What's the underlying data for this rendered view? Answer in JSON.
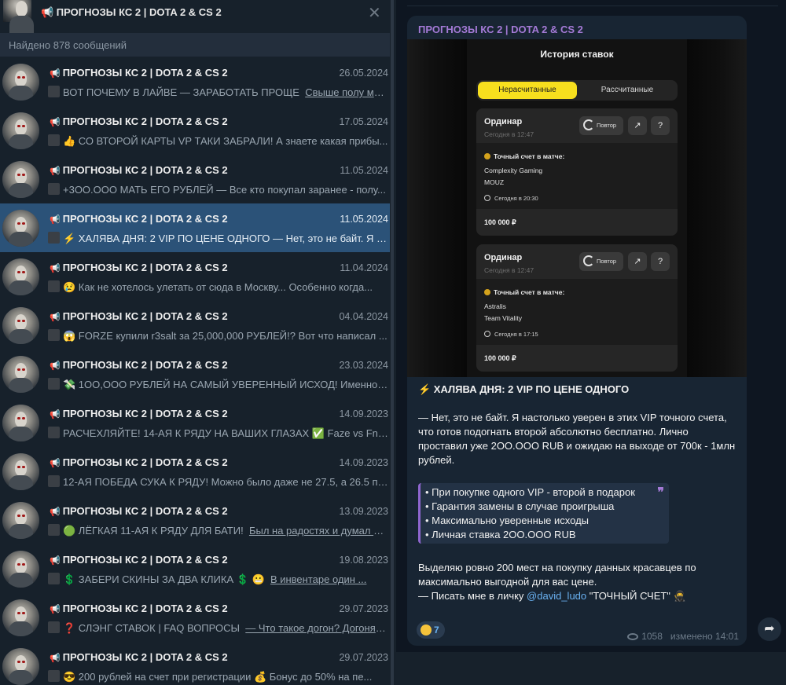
{
  "header": {
    "title": "📢 ПРОГНОЗЫ КС 2 | DOTA 2 & CS 2",
    "close_glyph": "✕"
  },
  "search": {
    "found_text": "Найдено 878 сообщений"
  },
  "results": [
    {
      "name": "ПРОГНОЗЫ КС 2 | DOTA 2 & CS 2",
      "date": "26.05.2024",
      "text": "ВОТ ПОЧЕМУ В ЛАЙВЕ — ЗАРАБОТАТЬ ПРОЩЕ",
      "extra": "Свыше полу мил..."
    },
    {
      "name": "ПРОГНОЗЫ КС 2 | DOTA 2 & CS 2",
      "date": "17.05.2024",
      "text": "👍 СО ВТОРОЙ КАРТЫ VP ТАКИ ЗАБРАЛИ!  А знаете какая прибы..."
    },
    {
      "name": "ПРОГНОЗЫ КС 2 | DOTA 2 & CS 2",
      "date": "11.05.2024",
      "text": "+3ОО.ООО МАТЬ ЕГО РУБЛЕЙ   — Все кто покупал заранее - полу..."
    },
    {
      "name": "ПРОГНОЗЫ КС 2 | DOTA 2 & CS 2",
      "date": "11.05.2024",
      "text": "⚡ ХАЛЯВА ДНЯ: 2 VIP ПО ЦЕНЕ ОДНОГО  — Нет, это не байт. Я н..."
    },
    {
      "name": "ПРОГНОЗЫ КС 2 | DOTA 2 & CS 2",
      "date": "11.04.2024",
      "text": "😢 Как не хотелось улетать от сюда в Москву...  Особенно когда..."
    },
    {
      "name": "ПРОГНОЗЫ КС 2 | DOTA 2 & CS 2",
      "date": "04.04.2024",
      "text": "😱 FORZE купили r3salt за 25,000,000 РУБЛЕЙ!?  Вот что написал ..."
    },
    {
      "name": "ПРОГНОЗЫ КС 2 | DOTA 2 & CS 2",
      "date": "23.03.2024",
      "text": "💸 1ОО,ООО РУБЛЕЙ НА САМЫЙ УВЕРЕННЫЙ ИСХОД!  Именно ..."
    },
    {
      "name": "ПРОГНОЗЫ КС 2 | DOTA 2 & CS 2",
      "date": "14.09.2023",
      "text": "РАСЧЕХЛЯЙТЕ! 14-АЯ К РЯДУ НА ВАШИХ ГЛАЗАХ  ✅ Faze vs Fnati..."
    },
    {
      "name": "ПРОГНОЗЫ КС 2 | DOTA 2 & CS 2",
      "date": "14.09.2023",
      "text": "12-АЯ ПОБЕДА СУКА К РЯДУ!  Можно было даже не 27.5, а 26.5 по..."
    },
    {
      "name": "ПРОГНОЗЫ КС 2 | DOTA 2 & CS 2",
      "date": "13.09.2023",
      "text": "🟢 ЛЁГКАЯ 11-АЯ К РЯДУ ДЛЯ БАТИ!",
      "extra": "Был на радостях и думал вы..."
    },
    {
      "name": "ПРОГНОЗЫ КС 2 | DOTA 2 & CS 2",
      "date": "19.08.2023",
      "text": "💲 ЗАБЕРИ СКИНЫ ЗА ДВА КЛИКА 💲 😬",
      "extra": "В инвентаре один ..."
    },
    {
      "name": "ПРОГНОЗЫ КС 2 | DOTA 2 & CS 2",
      "date": "29.07.2023",
      "text": "❓ СЛЭНГ СТАВОК | FAQ ВОПРОСЫ",
      "extra": "— Что такое догон? Догоняют..."
    },
    {
      "name": "ПРОГНОЗЫ КС 2 | DOTA 2 & CS 2",
      "date": "29.07.2023",
      "text": "😎 200 рублей на счет при регистрации  💰 Бонус до 50% на пе..."
    }
  ],
  "post": {
    "channel": "ПРОГНОЗЫ КС 2 | DOTA 2 & CS 2",
    "screenshot": {
      "title": "История ставок",
      "tab_active": "Нерасчитанные",
      "tab_inactive": "Рассчитанные",
      "cards": [
        {
          "type": "Ординар",
          "time": "Сегодня в 12:47",
          "repeat": "Повтор",
          "label": "Точный счет в матче:",
          "team1": "Complexity Gaming",
          "team2": "MOUZ",
          "match_time": "Сегодня в 20:30",
          "amount": "100 000 ₽"
        },
        {
          "type": "Ординар",
          "time": "Сегодня в 12:47",
          "repeat": "Повтор",
          "label": "Точный счет в матче:",
          "team1": "Astralis",
          "team2": "Team Vitality",
          "match_time": "Сегодня в 17:15",
          "amount": "100 000 ₽"
        }
      ]
    },
    "headline": "⚡ ХАЛЯВА ДНЯ: 2 VIP ПО ЦЕНЕ ОДНОГО",
    "paragraph1": "— Нет, это не байт. Я настолько уверен в этих VIP точного счета, что готов подогнать второй абсолютно бесплатно. Лично проставил уже 2ОО.ООО RUB и ожидаю на выходе от 700к - 1млн рублей.",
    "quote": [
      "• При покупке одного VIP - второй в подарок",
      "• Гарантия замены в случае проигрыша",
      "• Максимально уверенные исходы",
      "• Личная ставка 2ОО.ООО RUB"
    ],
    "paragraph2_line1": "Выделяю ровно 200 мест на покупку данных красавцев по максимально выгодной для вас цене.",
    "paragraph2_prefix": "— Писать мне в личку ",
    "paragraph2_link": "@david_ludo",
    "paragraph2_suffix": " \"ТОЧНЫЙ СЧЕТ\" 🥷",
    "reaction_count": "7",
    "views": "1058",
    "edited": "изменено 14:01"
  },
  "colors": {
    "accent": "#2b5278",
    "channel_name": "#a47ad6",
    "link": "#6ab2f2",
    "highlight_tab": "#f7df1e"
  }
}
